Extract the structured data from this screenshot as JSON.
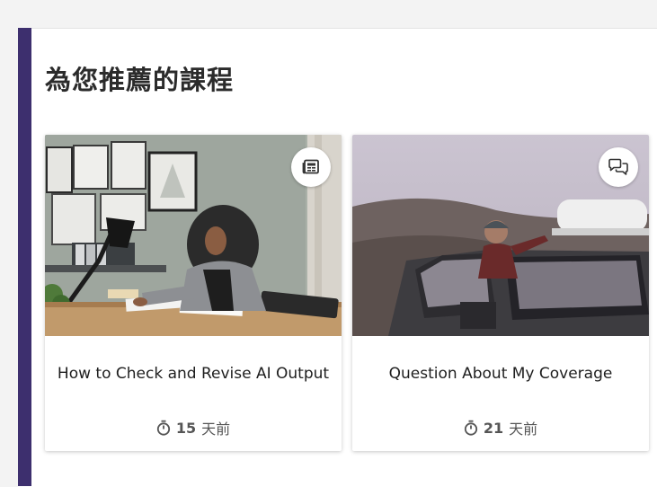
{
  "section": {
    "title": "為您推薦的課程"
  },
  "cards": [
    {
      "title": "How to Check and Revise AI Output",
      "time_value": "15",
      "time_unit": "天前",
      "type_icon": "news-icon"
    },
    {
      "title": "Question About My Coverage",
      "time_value": "21",
      "time_unit": "天前",
      "type_icon": "chat-bubbles-icon"
    }
  ],
  "colors": {
    "accent": "#3d2f6e",
    "page_bg": "#f3f3f3",
    "card_bg": "#ffffff"
  }
}
